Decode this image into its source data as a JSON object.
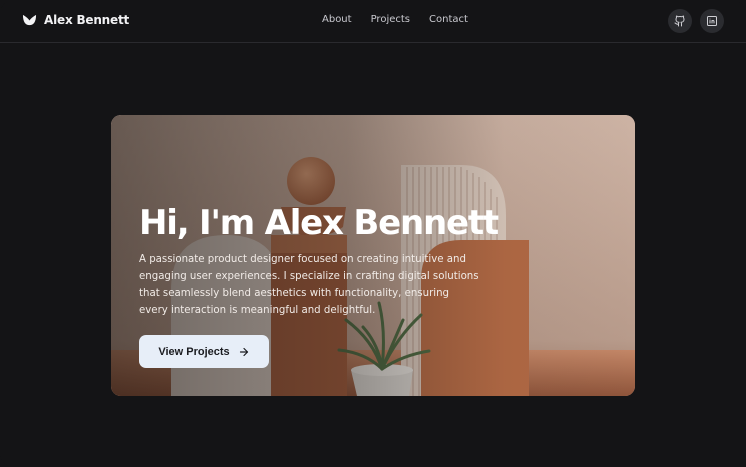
{
  "header": {
    "brand_name": "Alex Bennett",
    "logo_icon": "tulip-icon",
    "nav": [
      {
        "label": "About"
      },
      {
        "label": "Projects"
      },
      {
        "label": "Contact"
      }
    ],
    "socials": [
      {
        "icon": "github-icon"
      },
      {
        "icon": "linkedin-icon"
      }
    ]
  },
  "hero": {
    "title": "Hi, I'm Alex Bennett",
    "description": "A passionate product designer focused on creating intuitive and engaging user experiences. I specialize in crafting digital solutions that seamlessly blend aesthetics with functionality, ensuring every interaction is meaningful and delightful.",
    "cta_label": "View Projects",
    "cta_icon": "arrow-right-icon"
  },
  "colors": {
    "background": "#141416",
    "header_border": "#2a2a2e",
    "cta_background": "#e7eef8",
    "terracotta": "#b36a45"
  }
}
